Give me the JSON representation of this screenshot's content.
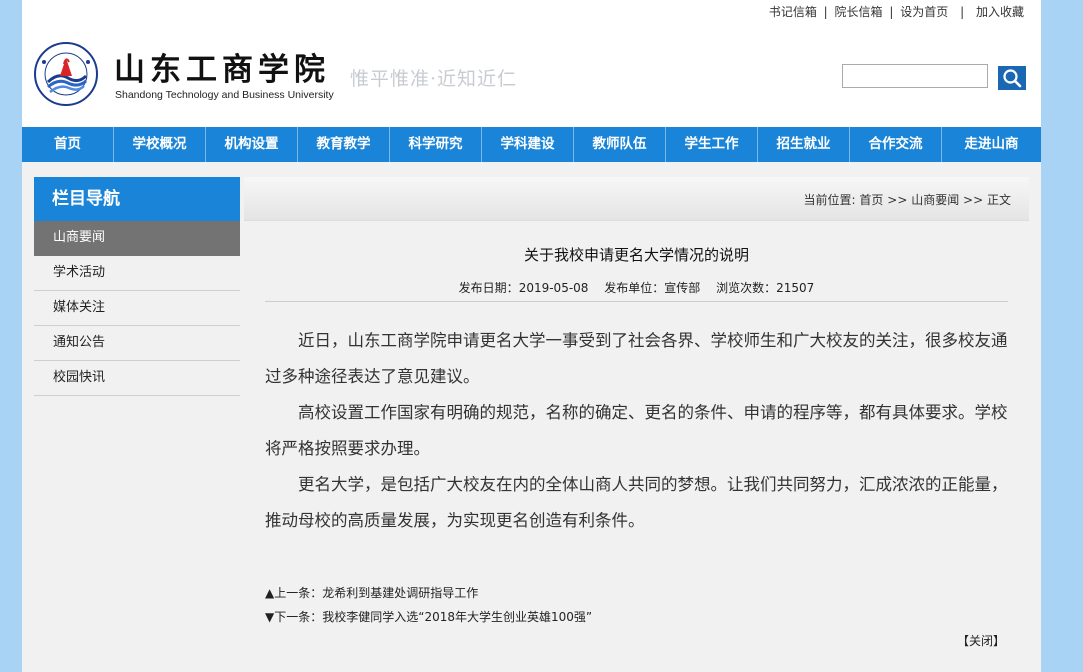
{
  "toplinks": {
    "secretary_mailbox": "书记信箱",
    "president_mailbox": "院长信箱",
    "set_homepage": "设为首页",
    "add_favorite": "加入收藏",
    "sep": "|"
  },
  "header": {
    "school_name_cn": "山东工商学院",
    "school_name_en": "Shandong Technology and Business University",
    "motto": "惟平惟准·近知近仁"
  },
  "search": {
    "value": "",
    "placeholder": ""
  },
  "nav": {
    "items": [
      "首页",
      "学校概况",
      "机构设置",
      "教育教学",
      "科学研究",
      "学科建设",
      "教师队伍",
      "学生工作",
      "招生就业",
      "合作交流",
      "走进山商"
    ]
  },
  "sidebar": {
    "title": "栏目导航",
    "items": [
      "山商要闻",
      "学术活动",
      "媒体关注",
      "通知公告",
      "校园快讯"
    ],
    "active_index": 0
  },
  "breadcrumb": {
    "label": "当前位置:",
    "home": "首页",
    "section": "山商要闻",
    "current": "正文",
    "sep": ">>"
  },
  "article": {
    "title": "关于我校申请更名大学情况的说明",
    "date_label": "发布日期：",
    "date": "2019-05-08",
    "unit_label": "发布单位：",
    "unit": "宣传部",
    "views_label": "浏览次数：",
    "views": "21507",
    "paragraphs": [
      "近日，山东工商学院申请更名大学一事受到了社会各界、学校师生和广大校友的关注，很多校友通过多种途径表达了意见建议。",
      "高校设置工作国家有明确的规范，名称的确定、更名的条件、申请的程序等，都有具体要求。学校将严格按照要求办理。",
      "更名大学，是包括广大校友在内的全体山商人共同的梦想。让我们共同努力，汇成浓浓的正能量，推动母校的高质量发展，为实现更名创造有利条件。"
    ],
    "prev_label": "▲上一条：",
    "prev_title": "龙希利到基建处调研指导工作",
    "next_label": "▼下一条：",
    "next_title": "我校李健同学入选“2018年大学生创业英雄100强”",
    "close_label": "【关闭】"
  },
  "colors": {
    "nav_blue": "#1a85d8",
    "search_blue": "#1a68b4",
    "page_bg": "#a9d3f4",
    "active_gray": "#737373"
  }
}
